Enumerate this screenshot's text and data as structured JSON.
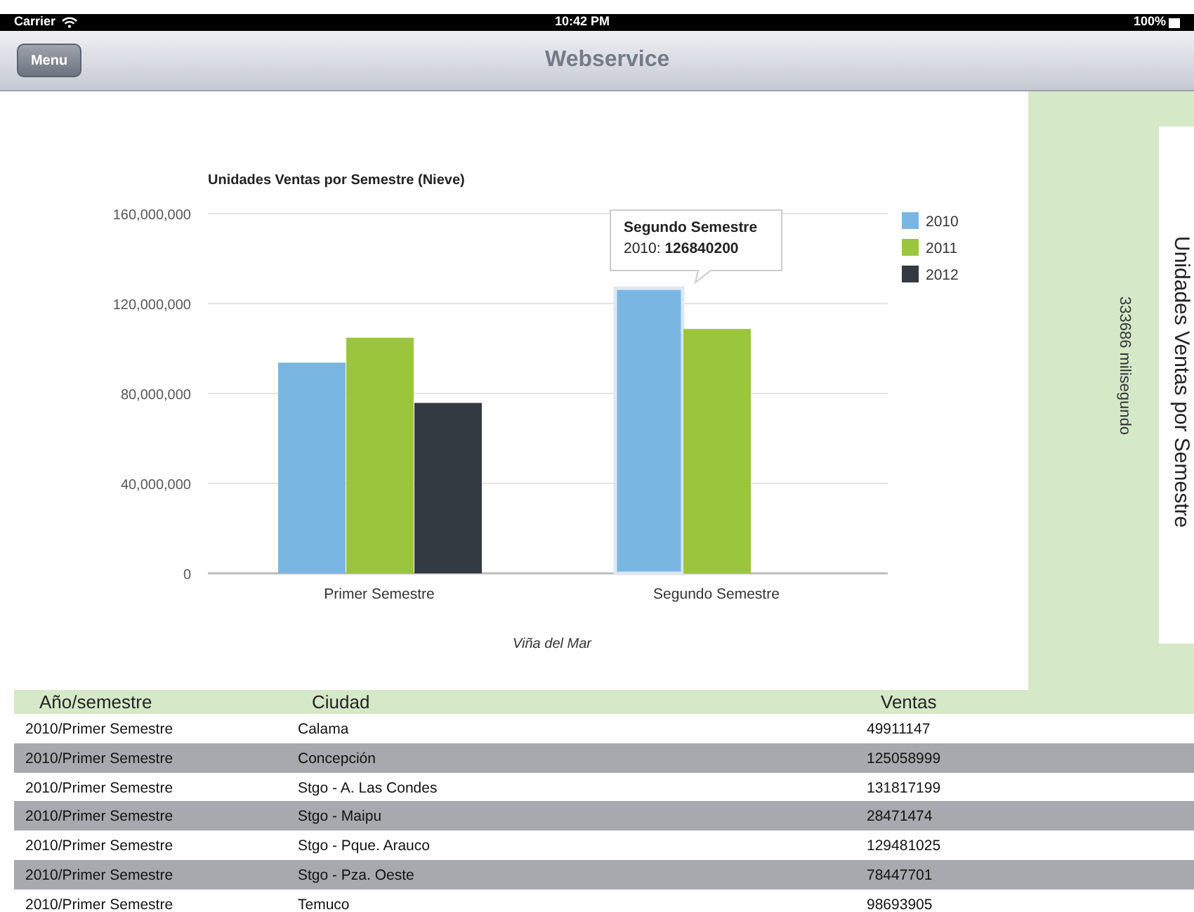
{
  "status_bar": {
    "carrier": "Carrier",
    "time": "10:42 PM",
    "battery": "100%"
  },
  "nav_bar": {
    "menu_button": "Menu",
    "title": "Webservice"
  },
  "chart": {
    "chart_data": {
      "type": "bar",
      "title": "Unidades Ventas por Semestre (Nieve)",
      "xlabel": "Viña del Mar",
      "categories": [
        "Primer Semestre",
        "Segundo Semestre"
      ],
      "series": [
        {
          "name": "2010",
          "color": "#7ab6e2",
          "values": [
            93700000,
            126800000
          ]
        },
        {
          "name": "2011",
          "color": "#9bc53d",
          "values": [
            104800000,
            108700000
          ]
        },
        {
          "name": "2012",
          "color": "#343a42",
          "values": [
            75800000,
            null
          ]
        }
      ],
      "grid": true,
      "legend": true,
      "ylim": [
        0,
        160000000
      ],
      "yticks": [
        {
          "value": 0,
          "label": "0"
        },
        {
          "value": 40000000,
          "label": "40,000,000"
        },
        {
          "value": 80000000,
          "label": "80,000,000"
        },
        {
          "value": 120000000,
          "label": "120,000,000"
        },
        {
          "value": 160000000,
          "label": "160,000,000"
        }
      ]
    },
    "highlighted_bars": [
      [
        false,
        true
      ],
      [
        false,
        false
      ],
      [
        false
      ]
    ],
    "tooltip": {
      "title": "Segundo Semestre",
      "text": "2010: **126840200**"
    }
  },
  "side_panel": {
    "elapsed": "333686 milisegundo",
    "card_title": "Unidades Ventas por Semestre"
  },
  "table": {
    "columns": [
      "Año/semestre",
      "Ciudad",
      "Ventas"
    ],
    "rows": [
      [
        "2010/Primer Semestre",
        "Calama",
        "49911147"
      ],
      [
        "2010/Primer Semestre",
        "Concepción",
        "125058999"
      ],
      [
        "2010/Primer Semestre",
        "Stgo - A. Las Condes",
        "131817199"
      ],
      [
        "2010/Primer Semestre",
        "Stgo - Maipu",
        "28471474"
      ],
      [
        "2010/Primer Semestre",
        "Stgo - Pque. Arauco",
        "129481025"
      ],
      [
        "2010/Primer Semestre",
        "Stgo - Pza. Oeste",
        "78447701"
      ],
      [
        "2010/Primer Semestre",
        "Temuco",
        "98693905"
      ]
    ]
  }
}
